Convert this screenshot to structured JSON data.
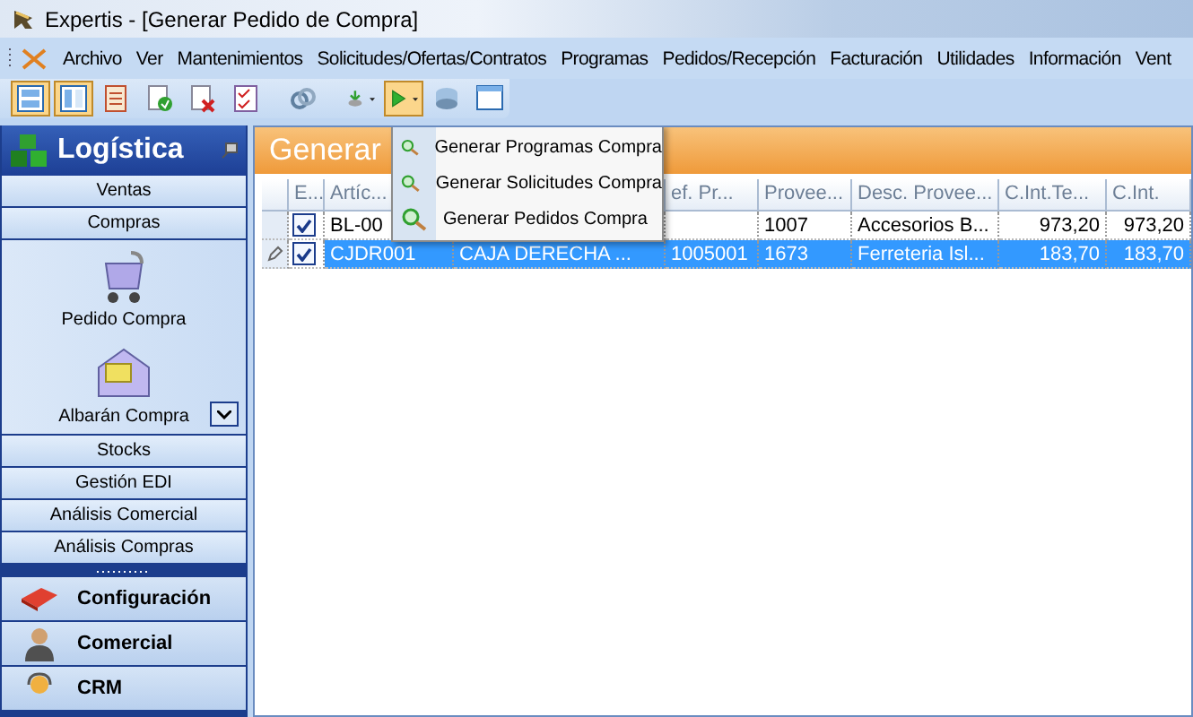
{
  "window": {
    "title": "Expertis - [Generar Pedido de Compra]"
  },
  "menu": [
    "Archivo",
    "Ver",
    "Mantenimientos",
    "Solicitudes/Ofertas/Contratos",
    "Programas",
    "Pedidos/Recepción",
    "Facturación",
    "Utilidades",
    "Información",
    "Vent"
  ],
  "toolbar": [
    {
      "kind": "button",
      "pressed": true
    },
    {
      "kind": "button",
      "pressed": true
    },
    {
      "kind": "button",
      "pressed": false
    },
    {
      "kind": "button",
      "pressed": false
    },
    {
      "kind": "button",
      "pressed": false
    },
    {
      "kind": "button",
      "pressed": false
    },
    {
      "kind": "separator"
    },
    {
      "kind": "button",
      "pressed": false
    },
    {
      "kind": "separator"
    },
    {
      "kind": "split",
      "pressed": false
    },
    {
      "kind": "split",
      "pressed": true
    },
    {
      "kind": "button",
      "pressed": false
    },
    {
      "kind": "button",
      "pressed": false
    }
  ],
  "sidebar": {
    "title": "Logística",
    "sections": [
      {
        "label": "Ventas"
      },
      {
        "label": "Compras",
        "items": [
          {
            "label": "Pedido Compra"
          },
          {
            "label": "Albarán Compra"
          }
        ]
      },
      {
        "label": "Stocks"
      },
      {
        "label": "Gestión EDI"
      },
      {
        "label": "Análisis Comercial"
      },
      {
        "label": "Análisis Compras"
      }
    ],
    "modules": [
      {
        "label": "Configuración"
      },
      {
        "label": "Comercial"
      },
      {
        "label": "CRM"
      }
    ]
  },
  "panel": {
    "title": "Generar"
  },
  "table": {
    "check_column": {
      "label": "E..."
    },
    "columns": [
      {
        "label": "Artíc..."
      },
      {},
      {
        "label": "ef. Pr..."
      },
      {
        "label": "Provee..."
      },
      {
        "label": "Desc. Provee..."
      },
      {
        "label": "C.Int.Te..."
      },
      {
        "label": "C.Int."
      }
    ],
    "rows": [
      {
        "selected": false,
        "editing": false,
        "checked": true,
        "cells": [
          "BL-00",
          null,
          null,
          "1007",
          "Accesorios B...",
          "973,20",
          "973,20"
        ]
      },
      {
        "selected": true,
        "editing": true,
        "checked": true,
        "cells": [
          "CJDR001",
          "CAJA DERECHA ...",
          "1005001",
          "1673",
          "Ferreteria Isl...",
          "183,70",
          "183,70"
        ]
      }
    ]
  },
  "dropdown_menu": {
    "items": [
      {
        "label": "Generar Programas Compra"
      },
      {
        "label": "Generar Solicitudes Compra"
      },
      {
        "label": "Generar Pedidos Compra"
      }
    ]
  }
}
